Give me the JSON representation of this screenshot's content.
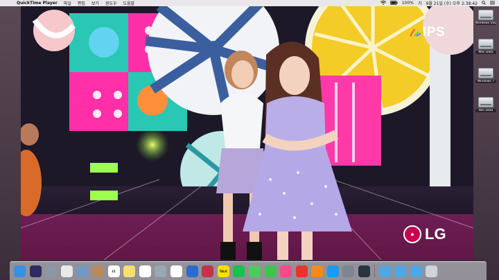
{
  "menubar": {
    "apple_glyph": "",
    "app_name": "QuickTime Player",
    "items": [
      "파일",
      "편집",
      "보기",
      "윈도우",
      "도움말"
    ],
    "status": {
      "wifi_icon": "wifi-icon",
      "battery": "100%",
      "input_source": "가",
      "clock": "9월 21일 (수) 오후 2:38:42"
    }
  },
  "video": {
    "broadcaster_logo": "IPS",
    "sponsor_logo": "LG"
  },
  "desktop_icons": [
    {
      "label": "Windows SSD"
    },
    {
      "label": "Mac Data"
    },
    {
      "label": "Windows 7"
    },
    {
      "label": "Win Data"
    }
  ],
  "dock": {
    "apps": [
      {
        "name": "finder",
        "color": "#3b8fe4"
      },
      {
        "name": "siri",
        "color": "#2c2c60"
      },
      {
        "name": "launchpad",
        "color": "#8a97a6"
      },
      {
        "name": "chrome",
        "color": "#e9e9e9"
      },
      {
        "name": "preview",
        "color": "#6f9ac4"
      },
      {
        "name": "contacts",
        "color": "#b98a5a"
      },
      {
        "name": "calendar",
        "color": "#ffffff",
        "text": "21"
      },
      {
        "name": "notes",
        "color": "#f5e070"
      },
      {
        "name": "reminders",
        "color": "#ffffff"
      },
      {
        "name": "image-capture",
        "color": "#9aa7b4"
      },
      {
        "name": "photos",
        "color": "#ffffff"
      },
      {
        "name": "keynote",
        "color": "#2a6bcd"
      },
      {
        "name": "photo-booth",
        "color": "#c6324a"
      },
      {
        "name": "kakaotalk",
        "color": "#f9e000",
        "text": "TALK"
      },
      {
        "name": "line",
        "color": "#19c24b"
      },
      {
        "name": "messages",
        "color": "#4acd5a"
      },
      {
        "name": "facetime",
        "color": "#3fc44c"
      },
      {
        "name": "itunes",
        "color": "#f24c8a"
      },
      {
        "name": "music-player",
        "color": "#e8352c"
      },
      {
        "name": "ibooks",
        "color": "#f28a1e"
      },
      {
        "name": "app-store",
        "color": "#1a9af0"
      },
      {
        "name": "system-preferences",
        "color": "#7d8590"
      },
      {
        "name": "quicktime",
        "color": "#2b3240"
      }
    ],
    "folders": [
      {
        "name": "applications-folder",
        "color": "#4fa7e6"
      },
      {
        "name": "documents-folder",
        "color": "#4fa7e6"
      },
      {
        "name": "downloads-folder",
        "color": "#4fa7e6"
      }
    ],
    "trash": {
      "name": "trash",
      "color": "#cfd4da"
    }
  }
}
